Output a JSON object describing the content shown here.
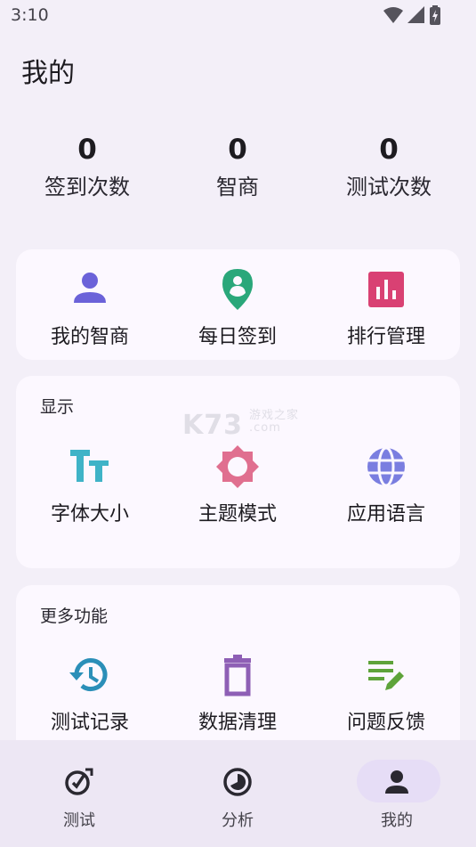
{
  "status": {
    "time": "3:10"
  },
  "page": {
    "title": "我的"
  },
  "stats": [
    {
      "value": "0",
      "label": "签到次数"
    },
    {
      "value": "0",
      "label": "智商"
    },
    {
      "value": "0",
      "label": "测试次数"
    }
  ],
  "quick_actions": [
    {
      "label": "我的智商",
      "icon": "person-icon",
      "color": "#6b62d9"
    },
    {
      "label": "每日签到",
      "icon": "location-pin-icon",
      "color": "#2aa77a"
    },
    {
      "label": "排行管理",
      "icon": "bar-chart-icon",
      "color": "#d94173"
    }
  ],
  "display_section": {
    "title": "显示",
    "items": [
      {
        "label": "字体大小",
        "icon": "font-size-icon",
        "color": "#3fb3c7"
      },
      {
        "label": "主题模式",
        "icon": "brightness-icon",
        "color": "#e06f8f"
      },
      {
        "label": "应用语言",
        "icon": "globe-icon",
        "color": "#7a7ee0"
      }
    ]
  },
  "more_section": {
    "title": "更多功能",
    "items": [
      {
        "label": "测试记录",
        "icon": "history-icon",
        "color": "#2b8fb8"
      },
      {
        "label": "数据清理",
        "icon": "trash-icon",
        "color": "#8e5fb5"
      },
      {
        "label": "问题反馈",
        "icon": "edit-list-icon",
        "color": "#5ea33a"
      }
    ]
  },
  "watermark": {
    "text": "K73",
    "sub": "游戏之家 .com"
  },
  "bottom_nav": [
    {
      "label": "测试",
      "icon": "check-compass-icon",
      "active": false
    },
    {
      "label": "分析",
      "icon": "pie-clock-icon",
      "active": false
    },
    {
      "label": "我的",
      "icon": "person-icon",
      "active": true
    }
  ]
}
